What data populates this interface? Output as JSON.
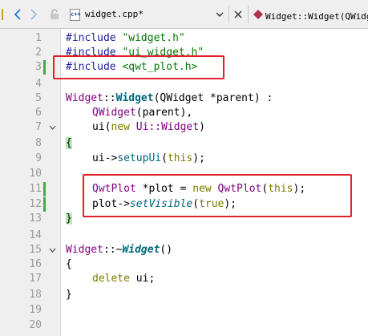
{
  "toolbar": {
    "file_name": "widget.cpp*",
    "file_icon_text": "c++",
    "symbol": "Widget::Widget(QWidge"
  },
  "lines": [
    {
      "no": "1"
    },
    {
      "no": "2"
    },
    {
      "no": "3"
    },
    {
      "no": "4"
    },
    {
      "no": "5"
    },
    {
      "no": "6"
    },
    {
      "no": "7"
    },
    {
      "no": "8"
    },
    {
      "no": "9"
    },
    {
      "no": "10"
    },
    {
      "no": "11"
    },
    {
      "no": "12"
    },
    {
      "no": "13"
    },
    {
      "no": "14"
    },
    {
      "no": "15"
    },
    {
      "no": "16"
    },
    {
      "no": "17"
    },
    {
      "no": "18"
    },
    {
      "no": "19"
    },
    {
      "no": "20"
    }
  ],
  "code": {
    "l1": {
      "a": "#include ",
      "b": "\"widget.h\""
    },
    "l2": {
      "a": "#include ",
      "b": "\"ui_widget.h\""
    },
    "l3": {
      "a": "#include ",
      "b": "<qwt_plot.h>"
    },
    "l5": {
      "a": "Widget",
      "b": "::",
      "c": "Widget",
      "d": "(QWidget *parent) :"
    },
    "l6": {
      "a": "QWidget",
      "b": "(parent),"
    },
    "l7": {
      "a": "ui",
      "b": "(",
      "c": "new",
      "d": " Ui::Widget",
      "e": ")"
    },
    "l8": {
      "a": "{"
    },
    "l9": {
      "a": "ui->",
      "b": "setupUi",
      "c": "(",
      "d": "this",
      "e": ");"
    },
    "l11": {
      "a": "QwtPlot",
      "b": " *plot = ",
      "c": "new",
      "d": " QwtPlot",
      "e": "(",
      "f": "this",
      "g": ");"
    },
    "l12": {
      "a": "plot->",
      "b": "setVisible",
      "c": "(",
      "d": "true",
      "e": ");"
    },
    "l13": {
      "a": "}"
    },
    "l15": {
      "a": "Widget",
      "b": "::~",
      "c": "Widget",
      "d": "()"
    },
    "l16": {
      "a": "{"
    },
    "l17": {
      "a": "delete",
      "b": " ui;"
    },
    "l18": {
      "a": "}"
    }
  },
  "colors": {
    "highlight_box": "#e0202a",
    "change_bar": "#4aa84a",
    "brace_highlight": "#b4eeb4"
  },
  "icons": [
    "arrow-left-icon",
    "arrow-right-icon",
    "lock-icon",
    "file-cpp-icon",
    "dropdown-icon",
    "close-icon",
    "symbol-icon",
    "fold-arrow-icon"
  ]
}
